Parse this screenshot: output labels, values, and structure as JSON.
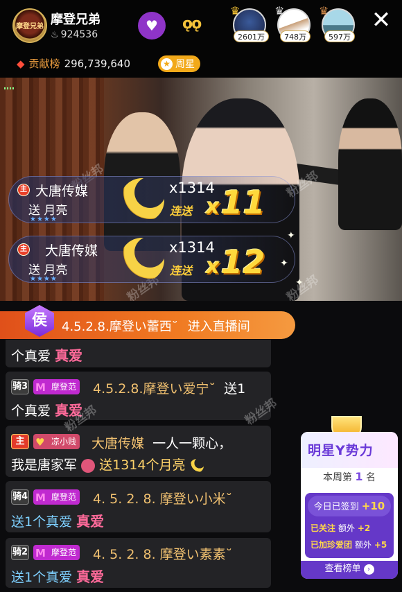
{
  "header": {
    "host_name": "摩登兄弟",
    "host_avatar_text": "摩登兄弟",
    "fans_count": "924536",
    "close_symbol": "✕",
    "top_viewers": [
      {
        "count": "2601万"
      },
      {
        "count": "748万"
      },
      {
        "count": "597万"
      }
    ],
    "contribution_label": "贡献榜",
    "contribution_value": "296,739,640",
    "weekly_star_label": "周星"
  },
  "video": {
    "watermark": "粉丝邦"
  },
  "gifts": [
    {
      "level": "主",
      "sender": "大唐传媒",
      "action": "送 月亮",
      "quantity": "x1314",
      "combo_label": "连送",
      "combo_x": "x",
      "combo_count": "11"
    },
    {
      "level": "主",
      "sender": "大唐传媒",
      "action": "送 月亮",
      "quantity": "x1314",
      "combo_label": "连送",
      "combo_x": "x",
      "combo_count": "12"
    }
  ],
  "entrance": {
    "badge": "侯",
    "user": "4.5.2.8.摩登い蕾西˘",
    "action": "进入直播间"
  },
  "chat": [
    {
      "text": "个真爱",
      "emoji": "真爱"
    },
    {
      "level": "骑3",
      "fan_badge": "摩登范",
      "user": "4.5.2.8.摩登い爱宁˘",
      "action": "送1",
      "line2": "个真爱",
      "emoji": "真爱"
    },
    {
      "level": "主",
      "fan_badge": "凉小贱",
      "user": "大唐传媒",
      "message": "一人一颗心，",
      "line2": "我是唐家军",
      "action": "送1314个月亮"
    },
    {
      "level": "骑4",
      "fan_badge": "摩登范",
      "user": "4. 5. 2. 8. 摩登い小米˘",
      "line2": "送1个真爱",
      "emoji": "真爱"
    },
    {
      "level": "骑2",
      "fan_badge": "摩登范",
      "user": "4. 5. 2. 8. 摩登い素素˘",
      "line2": "送1个真爱",
      "emoji": "真爱"
    }
  ],
  "star_card": {
    "title": "明星Y势力",
    "rank_prefix": "本周第",
    "rank": "1",
    "rank_suffix": "名",
    "checkin_label": "今日已签到",
    "checkin_bonus": "+10",
    "follow_label": "已关注",
    "follow_extra": "额外",
    "follow_bonus": "+2",
    "club_label": "已加珍爱团",
    "club_extra": "额外",
    "club_bonus": "+5",
    "button": "查看榜单"
  },
  "colors": {
    "accent_purple": "#8f34c8",
    "orange": "#f07a22",
    "gold": "#ffd93c"
  }
}
